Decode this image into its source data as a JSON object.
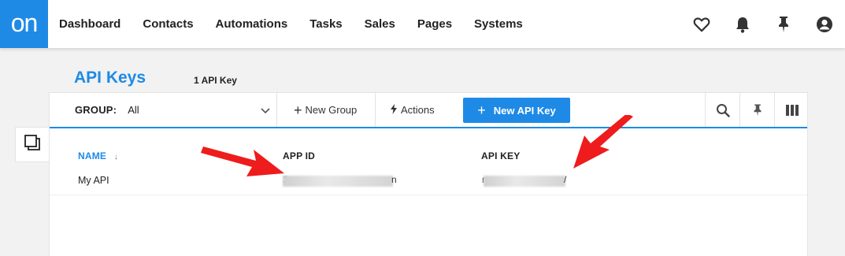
{
  "logo": "on",
  "nav": {
    "items": [
      "Dashboard",
      "Contacts",
      "Automations",
      "Tasks",
      "Sales",
      "Pages",
      "Systems"
    ],
    "icons": [
      "heart-icon",
      "bell-icon",
      "pin-icon",
      "user-icon"
    ]
  },
  "page": {
    "title": "API Keys",
    "count": "1 API Key"
  },
  "toolbar": {
    "group_label": "GROUP:",
    "group_value": "All",
    "new_group": "New Group",
    "actions": "Actions",
    "new_key": "New API Key"
  },
  "table": {
    "columns": [
      "NAME",
      "APP ID",
      "API KEY"
    ],
    "sort_indicator": "↓",
    "rows": [
      {
        "name": "My API",
        "app_id_visible_start": "2",
        "app_id_visible_end": "n",
        "api_key_visible_start": "r",
        "api_key_visible_end": "/"
      }
    ]
  },
  "colors": {
    "accent": "#1e8ae6",
    "arrow": "#ee1c1c"
  }
}
